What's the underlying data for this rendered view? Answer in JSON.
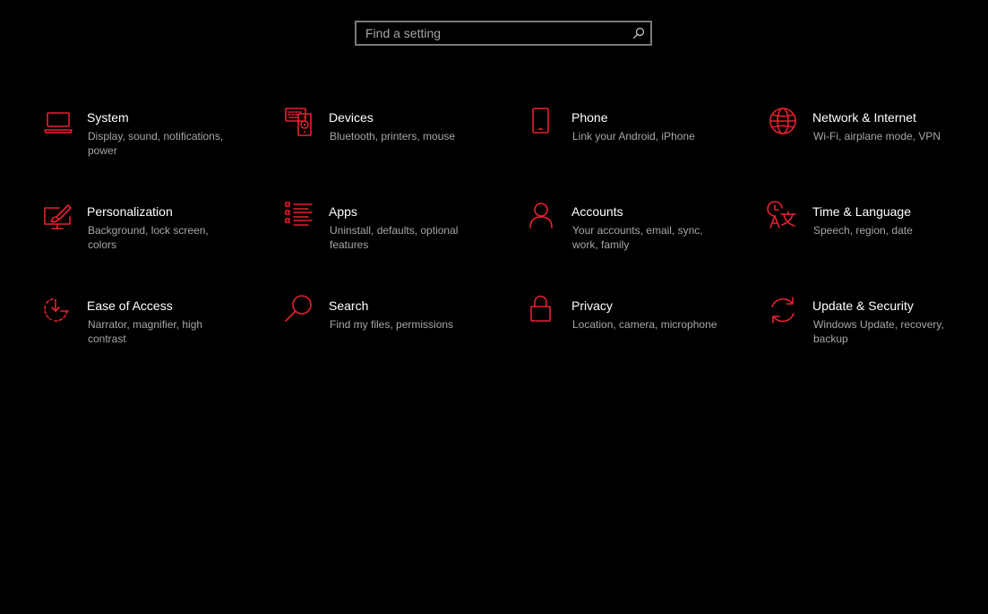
{
  "search": {
    "placeholder": "Find a setting",
    "icon": "search-icon"
  },
  "accent_color": "#e8212f",
  "tiles": [
    {
      "title": "System",
      "desc": "Display, sound, notifications, power",
      "icon": "laptop-icon"
    },
    {
      "title": "Devices",
      "desc": "Bluetooth, printers, mouse",
      "icon": "keyboard-speaker-icon"
    },
    {
      "title": "Phone",
      "desc": "Link your Android, iPhone",
      "icon": "phone-icon"
    },
    {
      "title": "Network & Internet",
      "desc": "Wi-Fi, airplane mode, VPN",
      "icon": "globe-icon"
    },
    {
      "title": "Personalization",
      "desc": "Background, lock screen, colors",
      "icon": "paint-monitor-icon"
    },
    {
      "title": "Apps",
      "desc": "Uninstall, defaults, optional features",
      "icon": "apps-list-icon"
    },
    {
      "title": "Accounts",
      "desc": "Your accounts, email, sync, work, family",
      "icon": "person-icon"
    },
    {
      "title": "Time & Language",
      "desc": "Speech, region, date",
      "icon": "time-language-icon"
    },
    {
      "title": "Ease of Access",
      "desc": "Narrator, magnifier, high contrast",
      "icon": "ease-of-access-icon"
    },
    {
      "title": "Search",
      "desc": "Find my files, permissions",
      "icon": "magnifier-icon"
    },
    {
      "title": "Privacy",
      "desc": "Location, camera, microphone",
      "icon": "lock-icon"
    },
    {
      "title": "Update & Security",
      "desc": "Windows Update, recovery, backup",
      "icon": "sync-arrows-icon"
    }
  ]
}
